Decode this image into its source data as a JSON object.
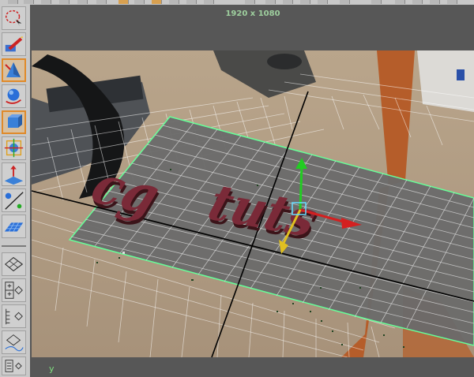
{
  "viewport": {
    "resolution_gate": "1920 x 1080",
    "axis_indicator": "y",
    "scene_text": "cg tuts"
  },
  "shelf": {
    "tools": [
      {
        "name": "lasso-select-tool",
        "active": false
      },
      {
        "name": "paint-select-tool",
        "active": false
      },
      {
        "name": "move-tool",
        "active": true
      },
      {
        "name": "rotate-tool",
        "active": false
      },
      {
        "name": "scale-tool",
        "active": true
      },
      {
        "name": "universal-manipulator-tool",
        "active": false
      },
      {
        "name": "soft-modification-tool",
        "active": false
      },
      {
        "name": "show-manipulator-tool",
        "active": false
      },
      {
        "name": "last-tool-used",
        "active": false
      }
    ],
    "layouts": [
      "single-pane-layout",
      "four-pane-layout",
      "outliner-layout",
      "hypershade-layout",
      "graph-editor-layout"
    ]
  },
  "colors": {
    "active_tool_border": "#e08a2a",
    "viewport_header": "#575757",
    "plane": "#6a6a6a",
    "plane_border": "#66ff99",
    "grid": "#ffffff",
    "text_3d": "#7a2a38",
    "axis_x": "#d42020",
    "axis_y": "#22cc22",
    "axis_z": "#e0c020"
  }
}
